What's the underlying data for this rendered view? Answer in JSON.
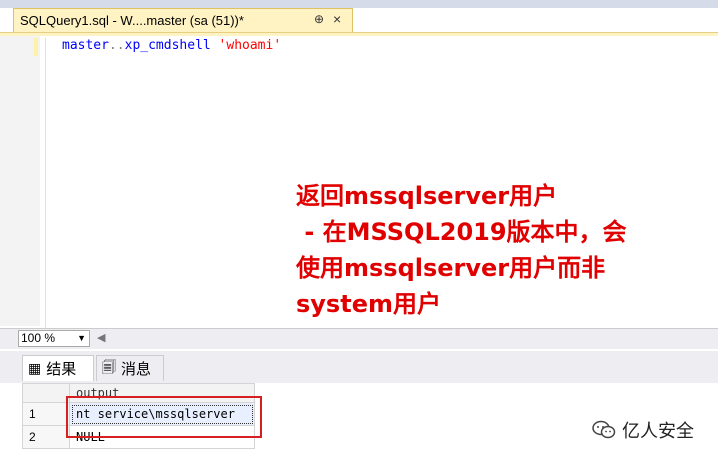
{
  "tab": {
    "title": "SQLQuery1.sql - W....master (sa (51))*",
    "pin_icon": "pin-icon",
    "close_icon": "close-icon"
  },
  "editor": {
    "code_parts": {
      "db": "master",
      "sep": "..",
      "proc": "xp_cmdshell",
      "space": " ",
      "arg": "'whoami'"
    }
  },
  "annotation": {
    "lines": [
      "返回mssqlserver用户",
      " - 在MSSQL2019版本中，会",
      "使用mssqlserver用户而非",
      "system用户"
    ]
  },
  "zoom": {
    "value": "100 %"
  },
  "results_tabs": [
    {
      "label": "结果",
      "icon": "grid-icon"
    },
    {
      "label": "消息",
      "icon": "messages-icon"
    }
  ],
  "grid": {
    "header": "output",
    "rows": [
      {
        "num": "1",
        "value": "nt service\\mssqlserver"
      },
      {
        "num": "2",
        "value": "NULL"
      }
    ]
  },
  "watermark": {
    "text": "亿人安全"
  },
  "colors": {
    "annotation": "#e00000",
    "keyword": "#0000ff",
    "string": "#ff0000",
    "highlight_box": "#d62020",
    "tab_active": "#fff3c4"
  }
}
